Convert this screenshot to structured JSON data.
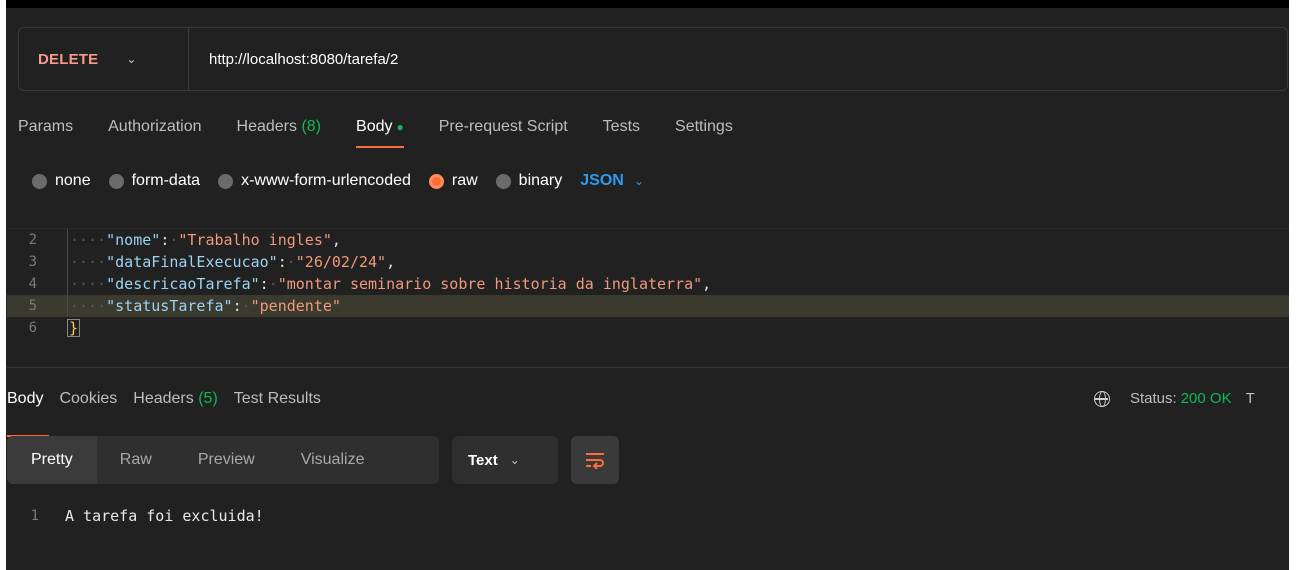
{
  "request": {
    "method": "DELETE",
    "url": "http://localhost:8080/tarefa/2"
  },
  "request_tabs": [
    {
      "label": "Params"
    },
    {
      "label": "Authorization"
    },
    {
      "label": "Headers",
      "count": "(8)"
    },
    {
      "label": "Body",
      "active": true
    },
    {
      "label": "Pre-request Script"
    },
    {
      "label": "Tests"
    },
    {
      "label": "Settings"
    }
  ],
  "body_types": [
    {
      "label": "none"
    },
    {
      "label": "form-data"
    },
    {
      "label": "x-www-form-urlencoded"
    },
    {
      "label": "raw",
      "selected": true
    },
    {
      "label": "binary"
    }
  ],
  "body_format": "JSON",
  "editor_lines": [
    {
      "n": "2",
      "key": "\"nome\"",
      "value": "\"Trabalho ingles\"",
      "trail": ","
    },
    {
      "n": "3",
      "key": "\"dataFinalExecucao\"",
      "value": "\"26/02/24\"",
      "trail": ","
    },
    {
      "n": "4",
      "key": "\"descricaoTarefa\"",
      "value": "\"montar seminario sobre historia da inglaterra\"",
      "trail": ","
    },
    {
      "n": "5",
      "key": "\"statusTarefa\"",
      "value": "\"pendente\"",
      "trail": ""
    },
    {
      "n": "6",
      "brace": "}"
    }
  ],
  "response_tabs": [
    {
      "label": "Body",
      "active": true
    },
    {
      "label": "Cookies"
    },
    {
      "label": "Headers",
      "count": "(5)"
    },
    {
      "label": "Test Results"
    }
  ],
  "status": {
    "label": "Status:",
    "value": "200 OK",
    "trailing": "T"
  },
  "view_modes": [
    "Pretty",
    "Raw",
    "Preview",
    "Visualize"
  ],
  "response_format": "Text",
  "response_body": {
    "n": "1",
    "text": "A tarefa foi excluida!"
  },
  "colors": {
    "accent": "#ff6c37",
    "method": "#f79a8e",
    "success": "#0cbb52",
    "link": "#2d9cf0"
  }
}
